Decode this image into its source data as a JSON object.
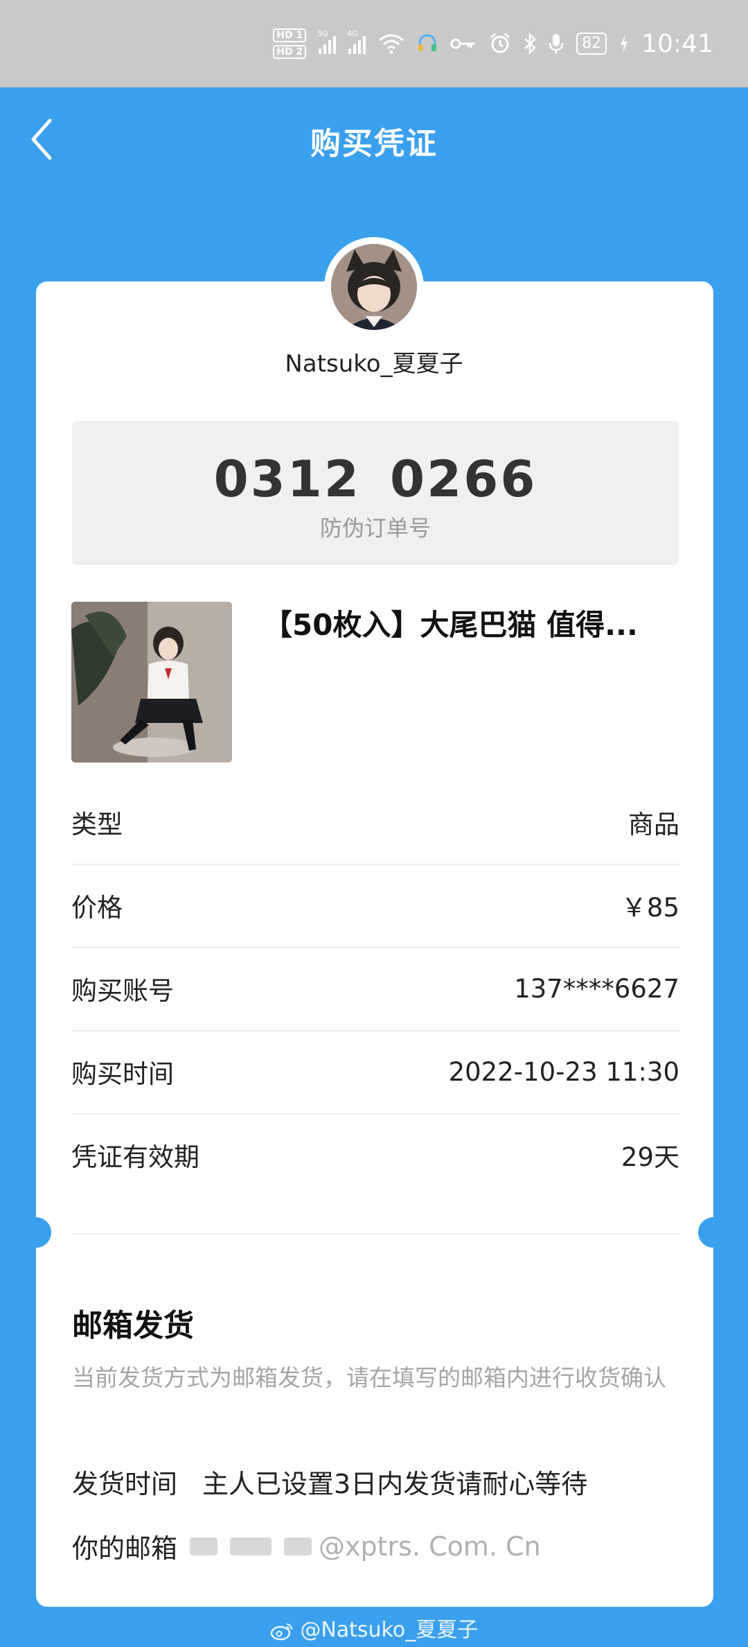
{
  "status_bar": {
    "sim1": "HD 1",
    "sim2": "HD 2",
    "net1": "5G",
    "net2": "4G",
    "battery": "82",
    "time": "10:41"
  },
  "header": {
    "title": "购买凭证"
  },
  "seller": {
    "name": "Natsuko_夏夏子"
  },
  "order": {
    "number": "0312  0266",
    "label": "防伪订单号"
  },
  "product": {
    "title": "【50枚入】大尾巴猫 值得..."
  },
  "details": [
    {
      "label": "类型",
      "value": "商品"
    },
    {
      "label": "价格",
      "value": "￥85"
    },
    {
      "label": "购买账号",
      "value": "137****6627"
    },
    {
      "label": "购买时间",
      "value": "2022-10-23 11:30"
    },
    {
      "label": "凭证有效期",
      "value": "29天"
    }
  ],
  "shipping": {
    "title": "邮箱发货",
    "description": "当前发货方式为邮箱发货，请在填写的邮箱内进行收货确认",
    "time_label": "发货时间",
    "time_value": "主人已设置3日内发货请耐心等待",
    "email_label": "你的邮箱",
    "email_suffix": "@xptrs. Com. Cn"
  },
  "watermark": "@Natsuko_夏夏子"
}
